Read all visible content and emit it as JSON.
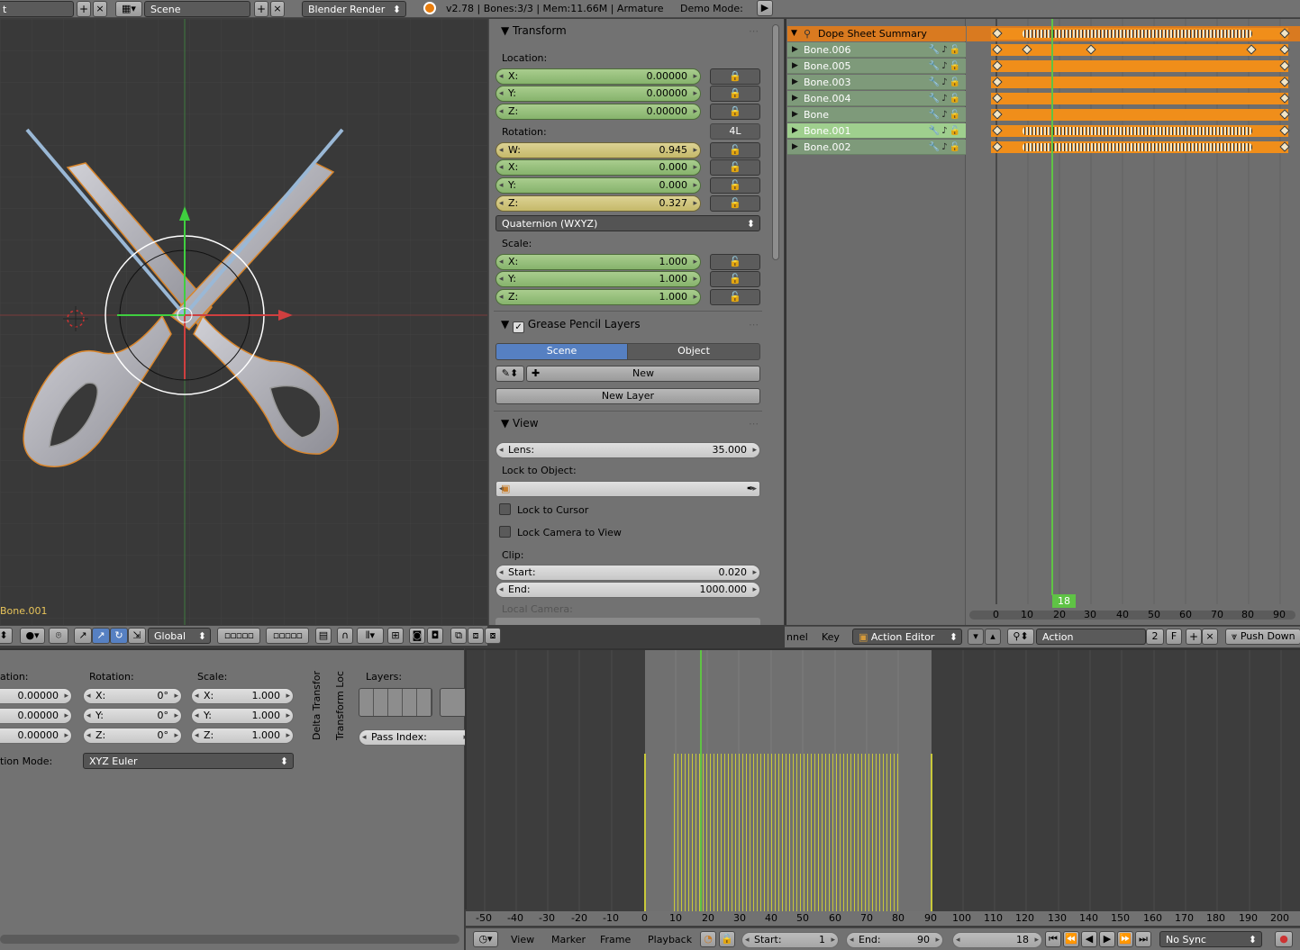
{
  "topbar": {
    "layout_field": "t",
    "scene_field": "Scene",
    "render_engine": "Blender Render",
    "stats": "v2.78 | Bones:3/3 | Mem:11.66M | Armature",
    "demo_mode": "Demo Mode:"
  },
  "viewport": {
    "object_name": "Bone.001",
    "header": {
      "orientation": "Global"
    }
  },
  "transform_panel": {
    "title": "Transform",
    "location_label": "Location:",
    "location": [
      {
        "axis": "X:",
        "value": "0.00000"
      },
      {
        "axis": "Y:",
        "value": "0.00000"
      },
      {
        "axis": "Z:",
        "value": "0.00000"
      }
    ],
    "rotation_label": "Rotation:",
    "rotation_lock_label": "4L",
    "rotation": [
      {
        "axis": "W:",
        "value": "0.945"
      },
      {
        "axis": "X:",
        "value": "0.000"
      },
      {
        "axis": "Y:",
        "value": "0.000"
      },
      {
        "axis": "Z:",
        "value": "0.327"
      }
    ],
    "rotation_mode": "Quaternion (WXYZ)",
    "scale_label": "Scale:",
    "scale": [
      {
        "axis": "X:",
        "value": "1.000"
      },
      {
        "axis": "Y:",
        "value": "1.000"
      },
      {
        "axis": "Z:",
        "value": "1.000"
      }
    ]
  },
  "grease_pencil": {
    "title": "Grease Pencil Layers",
    "tab_scene": "Scene",
    "tab_object": "Object",
    "new_label": "New",
    "new_layer_label": "New Layer"
  },
  "view_panel": {
    "title": "View",
    "lens_label": "Lens:",
    "lens_value": "35.000",
    "lock_object_label": "Lock to Object:",
    "lock_cursor_label": "Lock to Cursor",
    "lock_camera_label": "Lock Camera to View",
    "clip_label": "Clip:",
    "clip_start_label": "Start:",
    "clip_start_value": "0.020",
    "clip_end_label": "End:",
    "clip_end_value": "1000.000",
    "local_camera_label": "Local Camera:"
  },
  "dopesheet": {
    "summary": "Dope Sheet Summary",
    "channels": [
      "Bone.006",
      "Bone.005",
      "Bone.003",
      "Bone.004",
      "Bone",
      "Bone.001",
      "Bone.002"
    ],
    "current_frame": "18",
    "ticks": [
      "0",
      "10",
      "20",
      "30",
      "40",
      "50",
      "60",
      "70",
      "80",
      "90"
    ],
    "header": {
      "channel_menu": "nnel",
      "key_menu": "Key",
      "mode": "Action Editor",
      "action_name": "Action",
      "users": "2",
      "fake_user": "F",
      "push_down": "Push Down"
    }
  },
  "properties": {
    "rotation_label": "Rotation:",
    "scale_label": "Scale:",
    "loc_values": [
      "0.00000",
      "0.00000",
      "0.00000"
    ],
    "rot_values": [
      {
        "axis": "X:",
        "value": "0°"
      },
      {
        "axis": "Y:",
        "value": "0°"
      },
      {
        "axis": "Z:",
        "value": "0°"
      }
    ],
    "scale_values": [
      {
        "axis": "X:",
        "value": "1.000"
      },
      {
        "axis": "Y:",
        "value": "1.000"
      },
      {
        "axis": "Z:",
        "value": "1.000"
      }
    ],
    "loc_label": "ation:",
    "rotation_mode_label": "tion Mode:",
    "rotation_mode": "XYZ Euler",
    "delta_label": "Delta Transfor",
    "transform_locks_label": "Transform Loc",
    "layers_label": "Layers:",
    "pass_index_label": "Pass Index:"
  },
  "timeline": {
    "ticks": [
      "-50",
      "-40",
      "-30",
      "-20",
      "-10",
      "0",
      "10",
      "20",
      "30",
      "40",
      "50",
      "60",
      "70",
      "80",
      "90",
      "100",
      "110",
      "120",
      "130",
      "140",
      "150",
      "160",
      "170",
      "180",
      "190",
      "200"
    ],
    "view_menu": "View",
    "marker_menu": "Marker",
    "frame_menu": "Frame",
    "playback_menu": "Playback",
    "start_label": "Start:",
    "start_value": "1",
    "end_label": "End:",
    "end_value": "90",
    "current_frame": "18",
    "sync": "No Sync"
  },
  "colors": {
    "accent_orange": "#f08e1a",
    "frame_line": "#5fc345",
    "selected_channel": "#9fcf8e",
    "keyframe_yellow": "#c9c93a"
  }
}
